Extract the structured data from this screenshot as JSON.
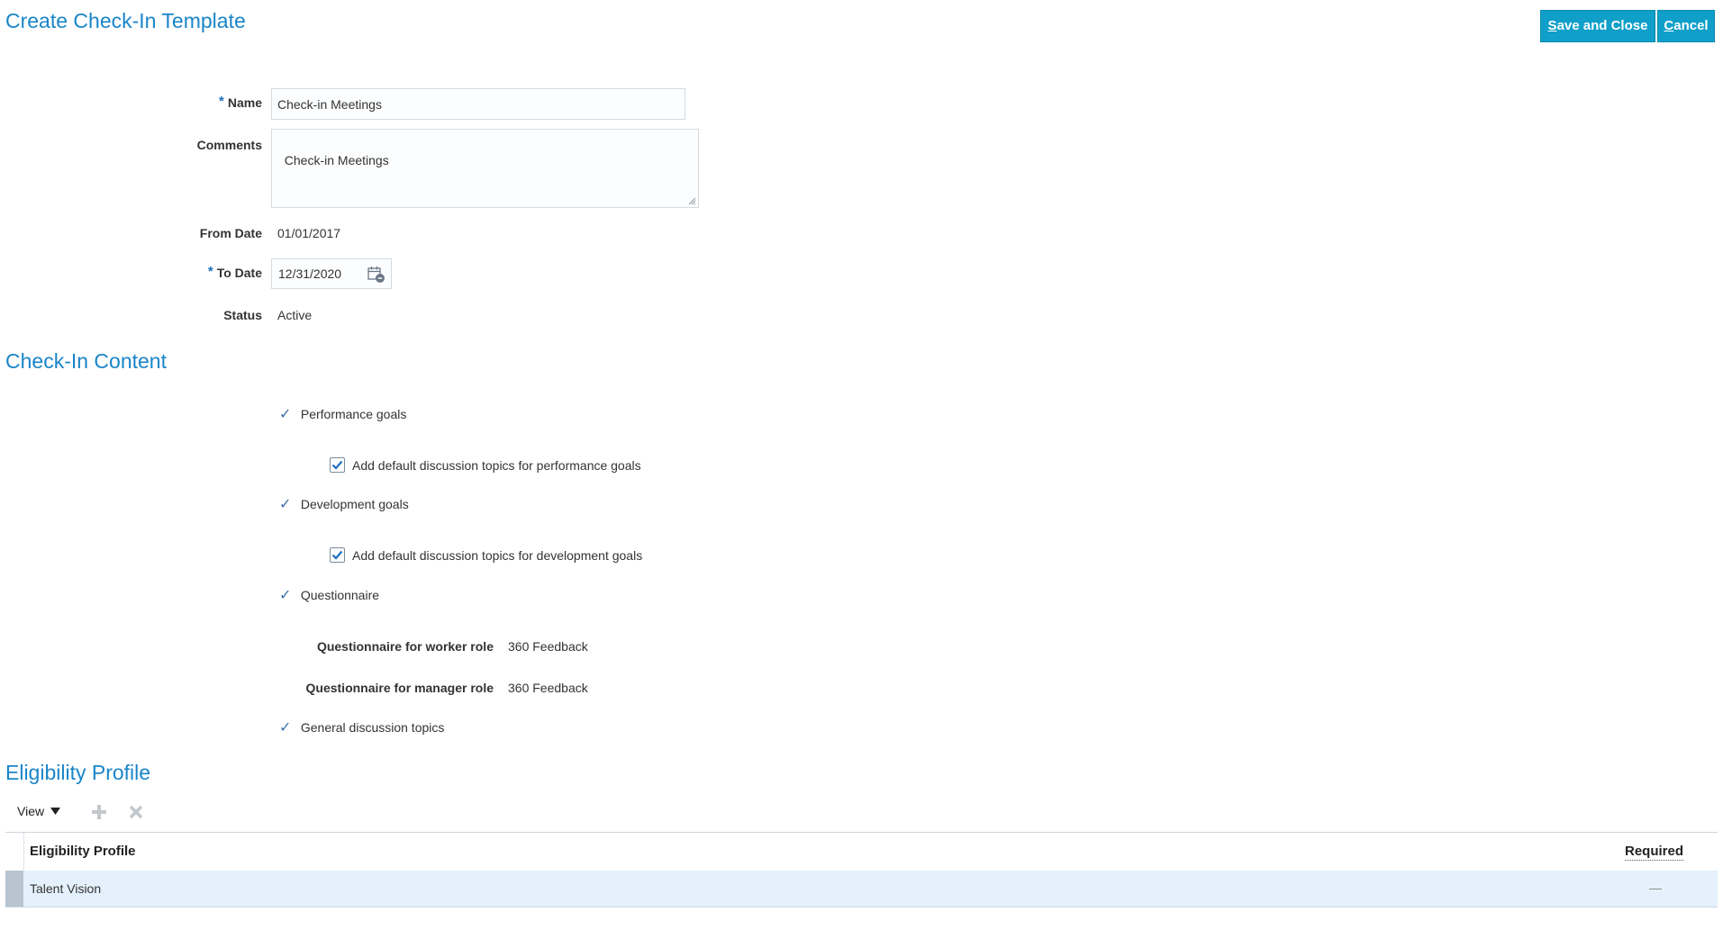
{
  "page": {
    "title": "Create Check-In Template"
  },
  "toolbar": {
    "save_label": "Save and Close",
    "save_key": "S",
    "save_rest": "ave and Close",
    "cancel_key": "C",
    "cancel_rest": "ancel"
  },
  "form": {
    "required_marker": "*",
    "name_label": "Name",
    "name_value": "Check-in Meetings",
    "comments_label": "Comments",
    "comments_value": "Check-in Meetings",
    "from_date_label": "From Date",
    "from_date_value": "01/01/2017",
    "to_date_label": "To Date",
    "to_date_value": "12/31/2020",
    "status_label": "Status",
    "status_value": "Active"
  },
  "content": {
    "title": "Check-In Content",
    "check_glyph": "✓",
    "performance_goals": "Performance goals",
    "perf_topics_label": "Add default discussion topics for performance goals",
    "perf_topics_checked": true,
    "development_goals": "Development goals",
    "dev_topics_label": "Add default discussion topics for development goals",
    "dev_topics_checked": true,
    "questionnaire": "Questionnaire",
    "worker_role_label": "Questionnaire for worker role",
    "worker_role_value": "360 Feedback",
    "manager_role_label": "Questionnaire for manager role",
    "manager_role_value": "360 Feedback",
    "general_topics": "General discussion topics"
  },
  "eligibility": {
    "title": "Eligibility Profile",
    "view_label": "View",
    "columns": [
      "Eligibility Profile",
      "Required"
    ],
    "rows": [
      {
        "profile": "Talent Vision",
        "required": "—"
      }
    ]
  },
  "colors": {
    "accent": "#1a85c8",
    "button": "#0f9fc9",
    "selected_row": "#e4f1fc"
  }
}
